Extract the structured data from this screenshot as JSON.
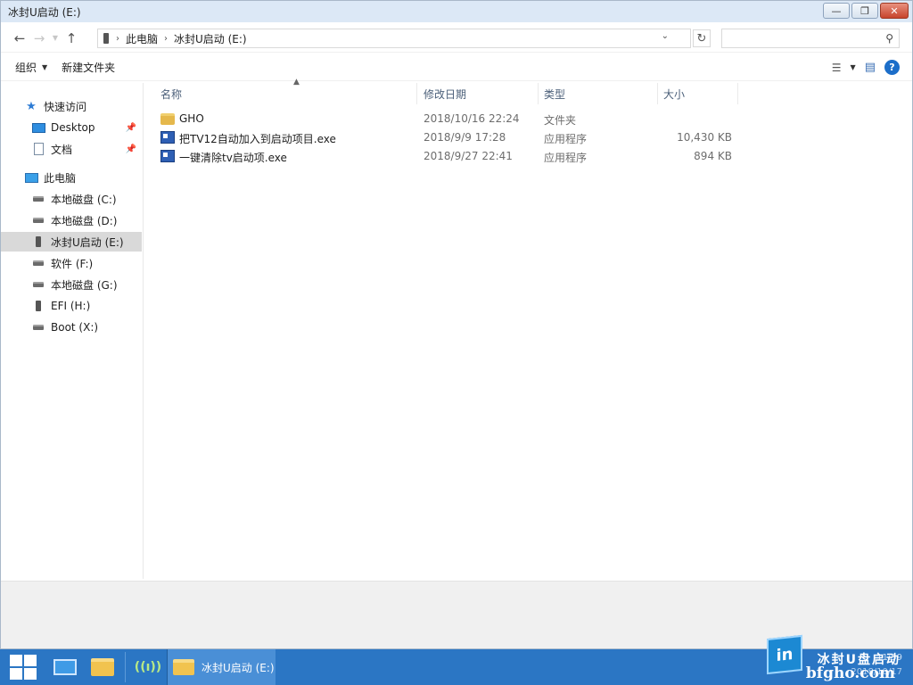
{
  "window": {
    "title": "冰封U启动 (E:)",
    "controls": {
      "minimize": "—",
      "maximize": "❐",
      "close": "✕"
    }
  },
  "address": {
    "crumbs": [
      "此电脑",
      "冰封U启动 (E:)"
    ],
    "search_placeholder": ""
  },
  "toolbar": {
    "organize": "组织",
    "new_folder": "新建文件夹"
  },
  "nav": {
    "quick_access": "快速访问",
    "desktop": "Desktop",
    "documents": "文档",
    "this_pc": "此电脑",
    "drives": [
      {
        "label": "本地磁盘 (C:)",
        "type": "drive"
      },
      {
        "label": "本地磁盘 (D:)",
        "type": "drive"
      },
      {
        "label": "冰封U启动 (E:)",
        "type": "usb",
        "selected": true
      },
      {
        "label": "软件 (F:)",
        "type": "drive"
      },
      {
        "label": "本地磁盘 (G:)",
        "type": "drive"
      },
      {
        "label": "EFI (H:)",
        "type": "usb"
      },
      {
        "label": "Boot (X:)",
        "type": "drive"
      }
    ]
  },
  "columns": {
    "name": "名称",
    "modified": "修改日期",
    "type": "类型",
    "size": "大小"
  },
  "files": [
    {
      "name": "GHO",
      "modified": "2018/10/16 22:24",
      "type": "文件夹",
      "size": "",
      "icon": "folder-icon"
    },
    {
      "name": "把TV12自动加入到启动项目.exe",
      "modified": "2018/9/9 17:28",
      "type": "应用程序",
      "size": "10,430 KB",
      "icon": "exe-icon"
    },
    {
      "name": "一键清除tv启动项.exe",
      "modified": "2018/9/27 22:41",
      "type": "应用程序",
      "size": "894 KB",
      "icon": "exe-icon"
    }
  ],
  "taskbar": {
    "active_window": "冰封U启动 (E:)",
    "brand_text": "冰封U盘启动",
    "brand_site": "bfgho.com",
    "brand_logo": "in",
    "clock_time": "11:59",
    "clock_date": "2018/10/17"
  },
  "colors": {
    "taskbar": "#2b76c4",
    "selection": "#d9d9d9",
    "header_text": "#4c607a"
  }
}
